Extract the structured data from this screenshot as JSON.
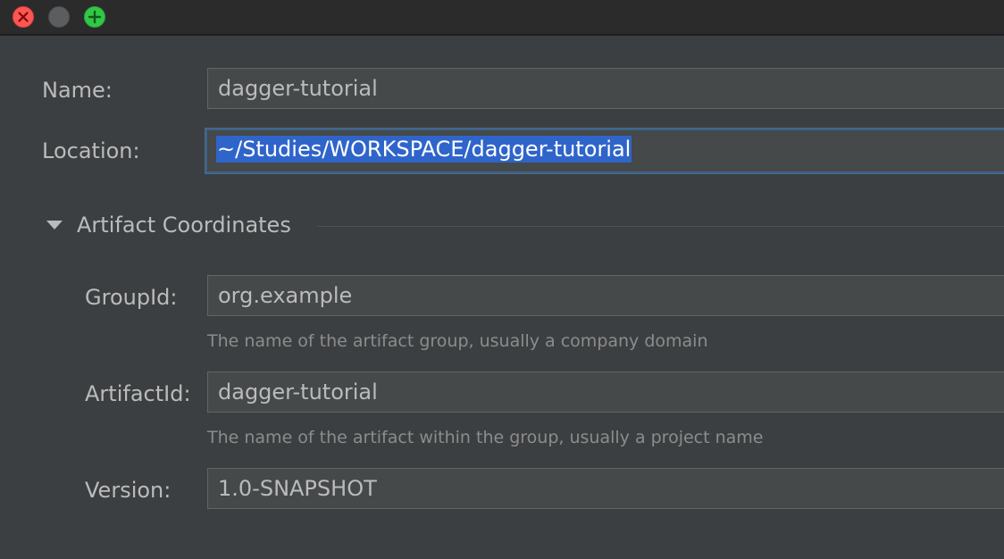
{
  "window": {
    "controls": {
      "close_icon": "close-icon",
      "minimize_icon": "minimize-icon",
      "zoom_icon": "plus-icon"
    }
  },
  "form": {
    "name": {
      "label": "Name:",
      "value": "dagger-tutorial"
    },
    "location": {
      "label": "Location:",
      "value": "~/Studies/WORKSPACE/dagger-tutorial",
      "selected": true
    }
  },
  "artifact_coordinates": {
    "title": "Artifact Coordinates",
    "expanded": true,
    "group_id": {
      "label": "GroupId:",
      "value": "org.example",
      "hint": "The name of the artifact group, usually a company domain"
    },
    "artifact_id": {
      "label": "ArtifactId:",
      "value": "dagger-tutorial",
      "hint": "The name of the artifact within the group, usually a project name"
    },
    "version": {
      "label": "Version:",
      "value": "1.0-SNAPSHOT"
    }
  },
  "colors": {
    "background": "#3c3f41",
    "field_background": "#45494a",
    "selection": "#2f65ca",
    "focus_border": "#3d6185",
    "text": "#bbbbbb",
    "hint_text": "#8c8c8c"
  }
}
